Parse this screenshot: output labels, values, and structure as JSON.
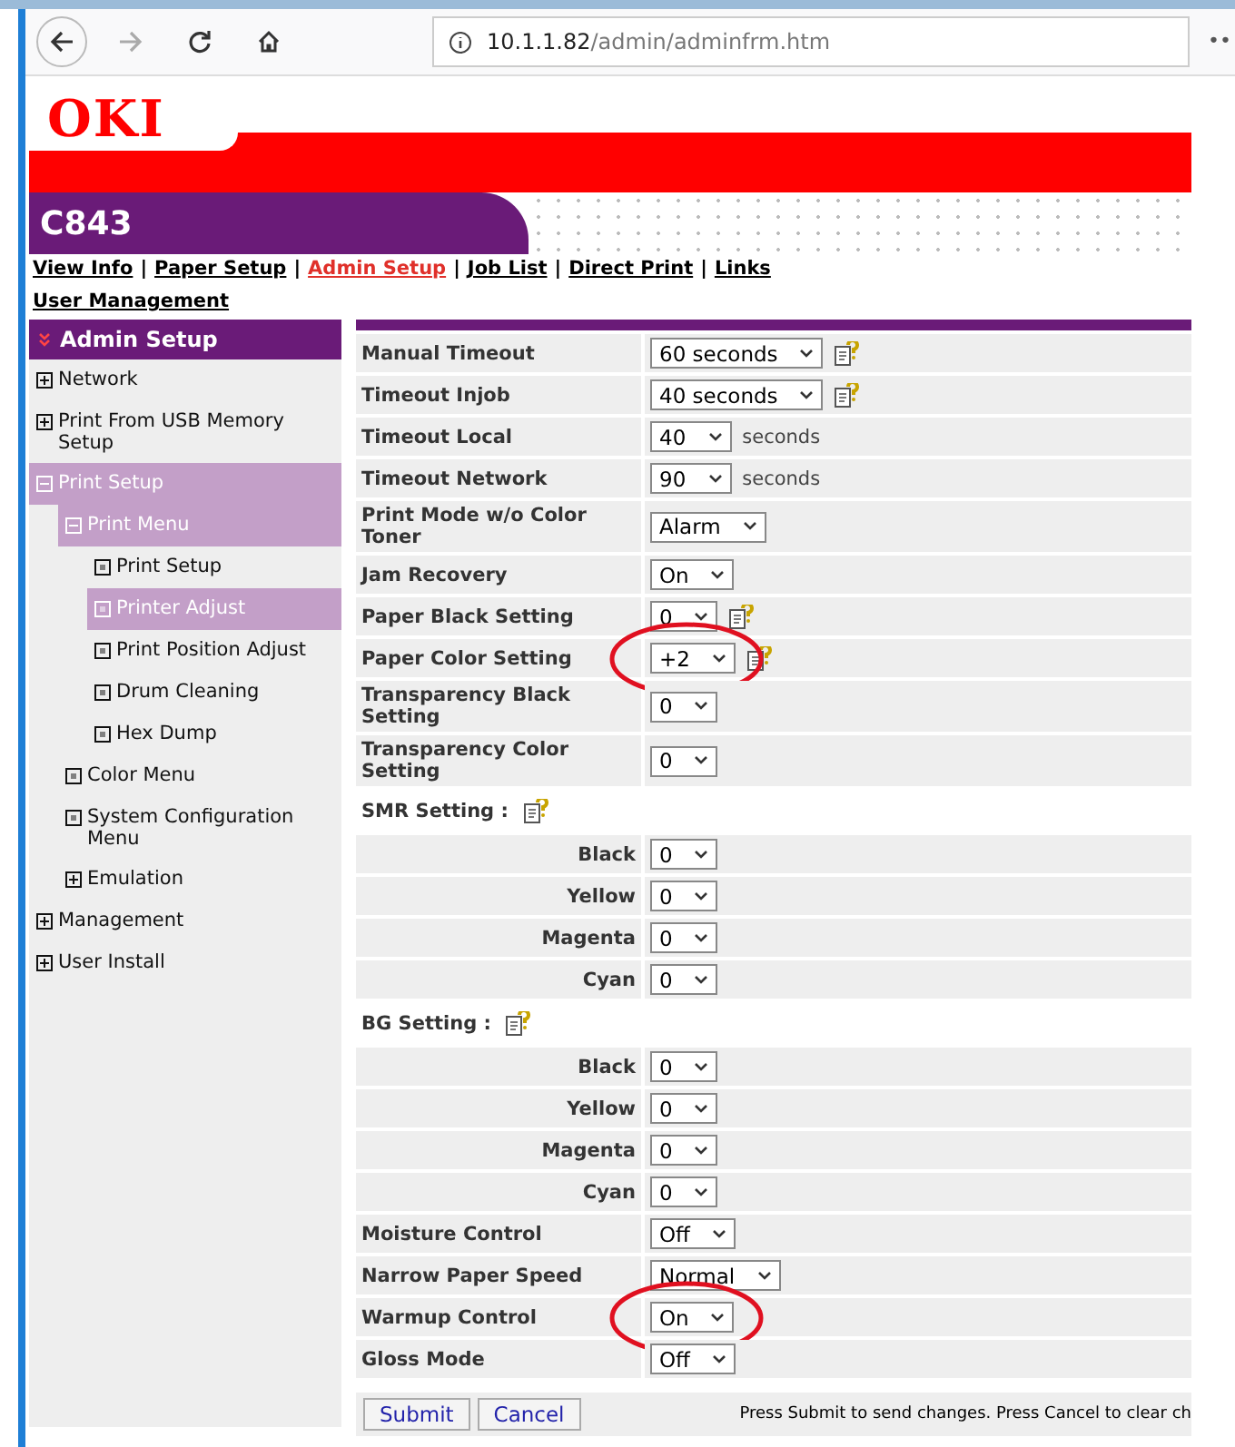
{
  "browser": {
    "url_host": "10.1.1.82",
    "url_path": "/admin/adminfrm.htm",
    "menu": "••"
  },
  "header": {
    "logo": "OKI",
    "model": "C843"
  },
  "nav": [
    {
      "label": "View Info",
      "selected": false,
      "separator": "|"
    },
    {
      "label": "Paper Setup",
      "selected": false,
      "separator": "|"
    },
    {
      "label": "Admin Setup",
      "selected": true,
      "separator": "|"
    },
    {
      "label": "Job List",
      "selected": false,
      "separator": "|"
    },
    {
      "label": "Direct Print",
      "selected": false,
      "separator": "|"
    },
    {
      "label": "Links",
      "selected": false
    },
    {
      "label": "User Management",
      "selected": false
    }
  ],
  "sidebar": {
    "title": "Admin Setup",
    "items": [
      {
        "label": "Network",
        "kind": "group",
        "expanded": false,
        "selected": false
      },
      {
        "label": "Print From USB Memory Setup",
        "kind": "group",
        "expanded": false,
        "selected": false
      },
      {
        "label": "Print Setup",
        "kind": "group",
        "expanded": true,
        "selected": true,
        "children": [
          {
            "label": "Print Menu",
            "kind": "group",
            "expanded": true,
            "selected": true,
            "children": [
              {
                "label": "Print Setup",
                "kind": "page",
                "selected": false
              },
              {
                "label": "Printer Adjust",
                "kind": "page",
                "selected": true
              },
              {
                "label": "Print Position Adjust",
                "kind": "page",
                "selected": false
              },
              {
                "label": "Drum Cleaning",
                "kind": "page",
                "selected": false
              },
              {
                "label": "Hex Dump",
                "kind": "page",
                "selected": false
              }
            ]
          },
          {
            "label": "Color Menu",
            "kind": "page",
            "selected": false
          },
          {
            "label": "System Configuration Menu",
            "kind": "page",
            "selected": false
          },
          {
            "label": "Emulation",
            "kind": "group",
            "expanded": false,
            "selected": false
          }
        ]
      },
      {
        "label": "Management",
        "kind": "group",
        "expanded": false,
        "selected": false
      },
      {
        "label": "User Install",
        "kind": "group",
        "expanded": false,
        "selected": false
      }
    ]
  },
  "settings": [
    {
      "kind": "setting",
      "label": "Manual Timeout",
      "value": "60 seconds",
      "help": true,
      "circled": false
    },
    {
      "kind": "setting",
      "label": "Timeout Injob",
      "value": "40 seconds",
      "help": true,
      "circled": false
    },
    {
      "kind": "setting",
      "label": "Timeout Local",
      "value": "40",
      "unit": "seconds",
      "help": false,
      "circled": false
    },
    {
      "kind": "setting",
      "label": "Timeout Network",
      "value": "90",
      "unit": "seconds",
      "help": false,
      "circled": false
    },
    {
      "kind": "setting",
      "label": "Print Mode w/o Color Toner",
      "value": "Alarm",
      "help": false,
      "circled": false
    },
    {
      "kind": "setting",
      "label": "Jam Recovery",
      "value": "On",
      "help": false,
      "circled": false
    },
    {
      "kind": "setting",
      "label": "Paper Black Setting",
      "value": "0",
      "help": true,
      "circled": false
    },
    {
      "kind": "setting",
      "label": "Paper Color Setting",
      "value": "+2",
      "help": true,
      "circled": true
    },
    {
      "kind": "setting",
      "label": "Transparency Black Setting",
      "value": "0",
      "help": false,
      "circled": false
    },
    {
      "kind": "setting",
      "label": "Transparency Color Setting",
      "value": "0",
      "help": false,
      "circled": false
    },
    {
      "kind": "section",
      "label": "SMR Setting :",
      "help": true
    },
    {
      "kind": "sub",
      "label": "Black",
      "value": "0"
    },
    {
      "kind": "sub",
      "label": "Yellow",
      "value": "0"
    },
    {
      "kind": "sub",
      "label": "Magenta",
      "value": "0"
    },
    {
      "kind": "sub",
      "label": "Cyan",
      "value": "0"
    },
    {
      "kind": "section",
      "label": "BG Setting :",
      "help": true
    },
    {
      "kind": "sub",
      "label": "Black",
      "value": "0"
    },
    {
      "kind": "sub",
      "label": "Yellow",
      "value": "0"
    },
    {
      "kind": "sub",
      "label": "Magenta",
      "value": "0"
    },
    {
      "kind": "sub",
      "label": "Cyan",
      "value": "0"
    },
    {
      "kind": "setting",
      "label": "Moisture Control",
      "value": "Off",
      "help": false,
      "circled": false
    },
    {
      "kind": "setting",
      "label": "Narrow Paper Speed",
      "value": "Normal",
      "help": false,
      "circled": false
    },
    {
      "kind": "setting",
      "label": "Warmup Control",
      "value": "On",
      "help": false,
      "circled": true
    },
    {
      "kind": "setting",
      "label": "Gloss Mode",
      "value": "Off",
      "help": false,
      "circled": false
    }
  ],
  "footer": {
    "buttons": [
      "Submit",
      "Cancel"
    ],
    "hint": "Press Submit to send changes. Press Cancel to clear ch"
  }
}
